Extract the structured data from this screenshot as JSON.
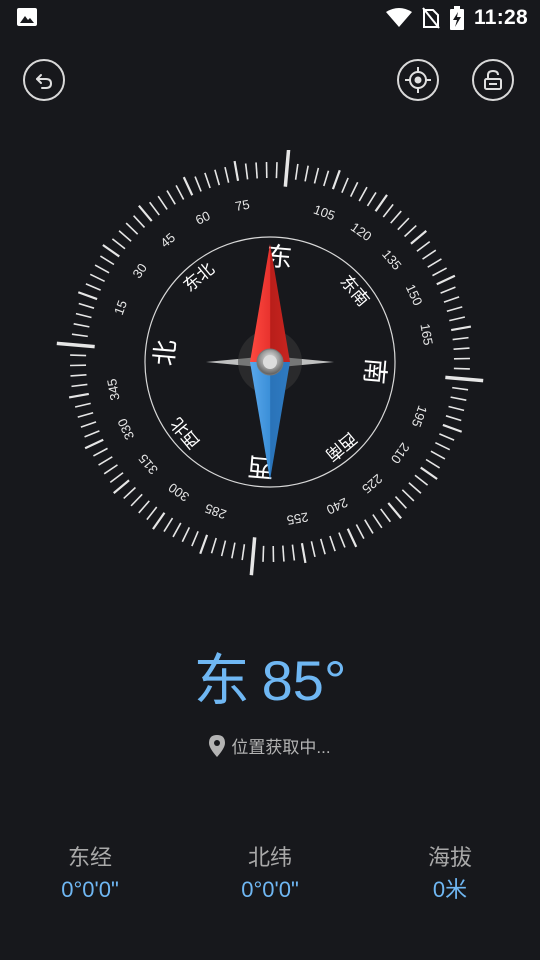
{
  "status_bar": {
    "time": "11:28"
  },
  "compass": {
    "ticks_labels": [
      "15",
      "30",
      "45",
      "60",
      "75",
      "105",
      "120",
      "135",
      "150",
      "165",
      "195",
      "210",
      "225",
      "240",
      "255",
      "285",
      "300",
      "315",
      "330",
      "345"
    ],
    "directions": {
      "north": "北",
      "east": "东",
      "south": "南",
      "west": "西",
      "northeast": "东北",
      "southeast": "东南",
      "southwest": "西南",
      "northwest": "西北"
    },
    "needle_colors": {
      "north": "#e8322e",
      "south": "#3b8fd8"
    },
    "rotation_deg": 85
  },
  "heading": {
    "direction": "东",
    "degrees": "85°"
  },
  "location": {
    "text": "位置获取中..."
  },
  "stats": {
    "longitude": {
      "label": "东经",
      "value": "0°0'0\""
    },
    "latitude": {
      "label": "北纬",
      "value": "0°0'0\""
    },
    "altitude": {
      "label": "海拔",
      "value": "0米"
    }
  },
  "theme": {
    "accent": "#6fb7f3",
    "background": "#17181c"
  }
}
